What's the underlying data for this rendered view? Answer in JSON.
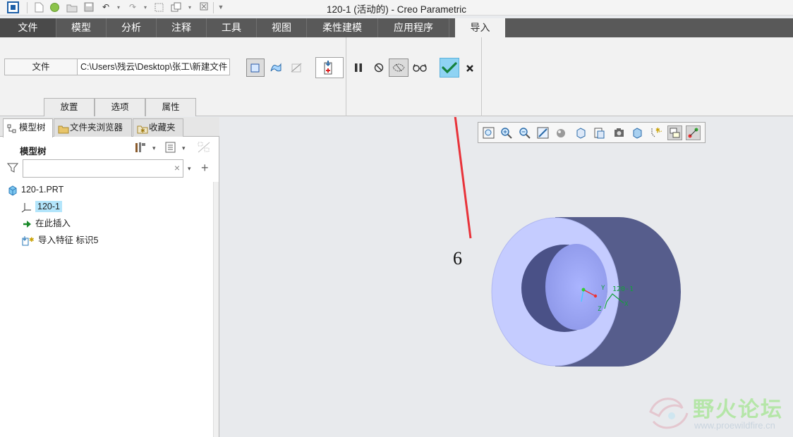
{
  "window": {
    "title": "120-1 (活动的) - Creo Parametric"
  },
  "ribbon_tabs": [
    "文件",
    "模型",
    "分析",
    "注释",
    "工具",
    "视图",
    "柔性建模",
    "应用程序",
    "导入"
  ],
  "active_tab": "导入",
  "import_ribbon": {
    "file_label": "文件",
    "file_path": "C:\\Users\\残云\\Desktop\\张工\\新建文件",
    "sub_tabs": [
      "放置",
      "选项",
      "属性"
    ]
  },
  "left_panel": {
    "tabs": [
      "模型树",
      "文件夹浏览器",
      "收藏夹"
    ],
    "tree_title": "模型树",
    "filter_placeholder": "",
    "tree_items": [
      {
        "label": "120-1.PRT",
        "icon": "part-icon"
      },
      {
        "label": "120-1",
        "icon": "coordinate-system-icon"
      },
      {
        "label": "在此插入",
        "icon": "insert-here-arrow-icon"
      },
      {
        "label": "导入特征 标识5",
        "icon": "import-feature-icon"
      }
    ]
  },
  "graphics": {
    "annotation_label": "6",
    "csys_label": "120-1",
    "axis_x": "X",
    "axis_y": "Y",
    "axis_z": "Z"
  },
  "watermark": {
    "text": "野火论坛",
    "url": "www.proewildfire.cn"
  },
  "colors": {
    "tab_bar": "#595959",
    "ok_button": "#8fd3f3",
    "arrow": "#e8333a",
    "part_face": "#c5ccff",
    "part_side": "#565d8c",
    "selection": "#b3e5fb"
  }
}
